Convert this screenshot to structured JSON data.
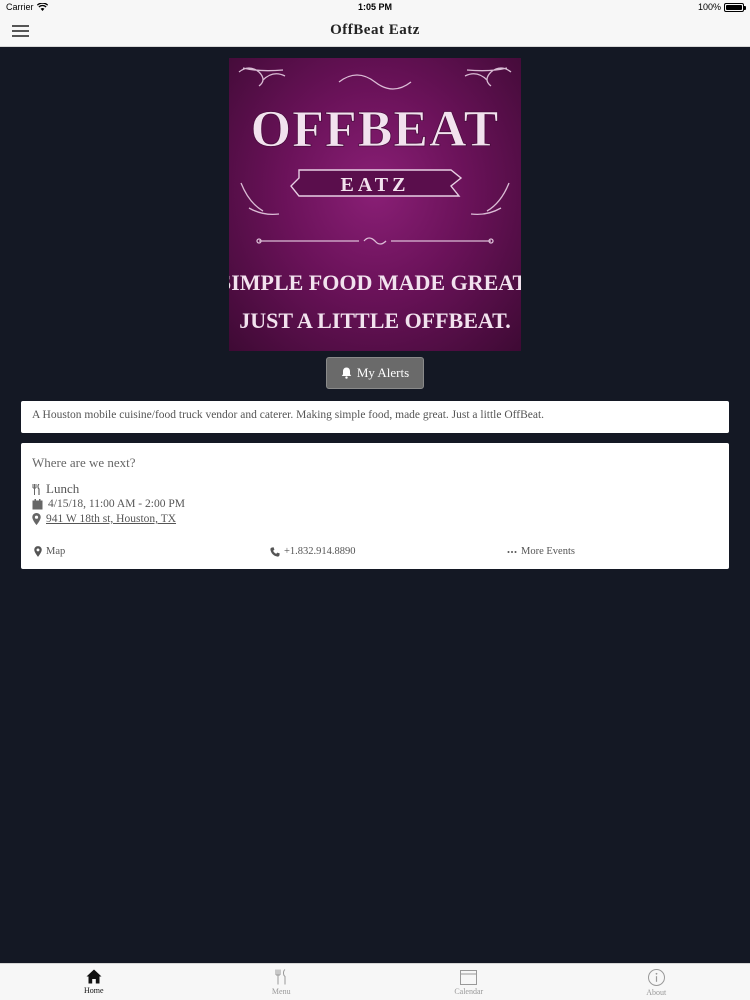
{
  "status_bar": {
    "carrier": "Carrier",
    "time": "1:05 PM",
    "battery": "100%"
  },
  "nav": {
    "title": "OffBeat Eatz"
  },
  "logo": {
    "brand_line1": "OFFBEAT",
    "brand_line2": "EATZ",
    "tagline_line1": "SIMPLE FOOD MADE GREAT.",
    "tagline_line2": "JUST A LITTLE OFFBEAT."
  },
  "alerts_button": {
    "label": "My Alerts"
  },
  "description": "A Houston mobile cuisine/food truck vendor and caterer. Making simple food, made great. Just a little OffBeat.",
  "event": {
    "heading": "Where are we next?",
    "meal": "Lunch",
    "datetime": "4/15/18, 11:00 AM - 2:00 PM",
    "address": "941 W 18th st, Houston, TX",
    "actions": {
      "map": "Map",
      "phone": "+1.832.914.8890",
      "more": "More Events"
    }
  },
  "tabs": [
    {
      "label": "Home",
      "icon": "home-icon",
      "active": true
    },
    {
      "label": "Menu",
      "icon": "utensils-icon",
      "active": false
    },
    {
      "label": "Calendar",
      "icon": "calendar-icon",
      "active": false
    },
    {
      "label": "About",
      "icon": "info-icon",
      "active": false
    }
  ],
  "colors": {
    "background": "#141824",
    "logo_purple": "#6a1259",
    "button_gray": "#6a6a6a"
  }
}
